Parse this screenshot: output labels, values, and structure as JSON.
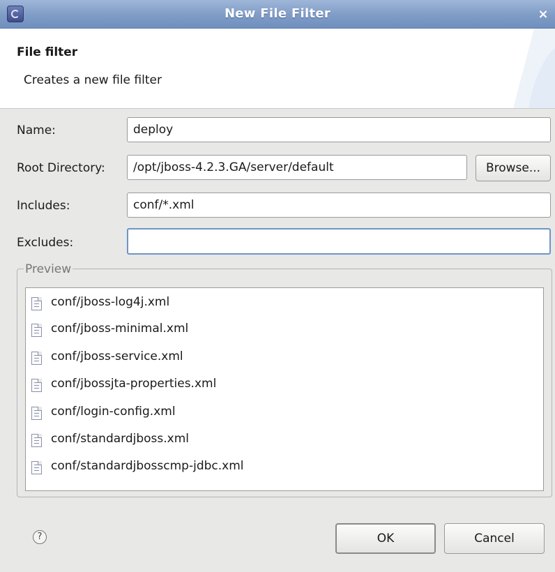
{
  "window": {
    "title": "New File Filter",
    "close_glyph": "×"
  },
  "header": {
    "title": "File filter",
    "description": "Creates a new file filter"
  },
  "form": {
    "name_label": "Name:",
    "name_value": "deploy",
    "root_label": "Root Directory:",
    "root_value": "/opt/jboss-4.2.3.GA/server/default",
    "browse_label": "Browse...",
    "includes_label": "Includes:",
    "includes_value": "conf/*.xml",
    "excludes_label": "Excludes:",
    "excludes_value": ""
  },
  "preview": {
    "legend": "Preview",
    "items": [
      "conf/jboss-log4j.xml",
      "conf/jboss-minimal.xml",
      "conf/jboss-service.xml",
      "conf/jbossjta-properties.xml",
      "conf/login-config.xml",
      "conf/standardjboss.xml",
      "conf/standardjbosscmp-jdbc.xml"
    ]
  },
  "footer": {
    "help_glyph": "?",
    "ok_label": "OK",
    "cancel_label": "Cancel"
  },
  "icons": {
    "app": "eclipse-icon",
    "help": "help-icon",
    "file": "file-icon",
    "close": "close-icon"
  }
}
